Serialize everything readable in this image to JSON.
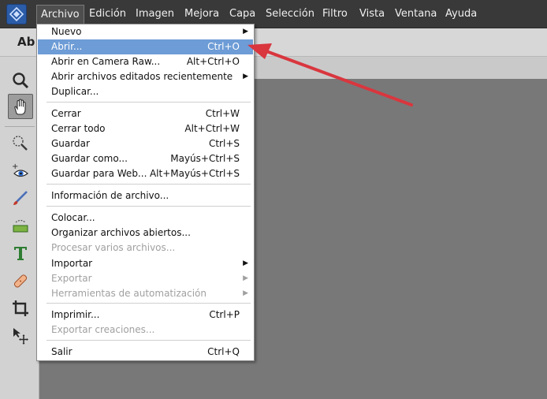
{
  "menubar": {
    "items": [
      {
        "label": "Archivo",
        "active": true
      },
      {
        "label": "Edición"
      },
      {
        "label": "Imagen"
      },
      {
        "label": "Mejora"
      },
      {
        "label": "Capa"
      },
      {
        "label": "Selección"
      },
      {
        "label": "Filtro"
      },
      {
        "label": "Vista"
      },
      {
        "label": "Ventana"
      },
      {
        "label": "Ayuda"
      }
    ]
  },
  "modebar": {
    "label": "Ab"
  },
  "toolbar": {
    "tools": [
      {
        "icon": "zoom-icon"
      },
      {
        "icon": "hand-icon",
        "selected": true
      },
      {
        "icon": "quick-selection-icon"
      },
      {
        "icon": "red-eye-icon"
      },
      {
        "icon": "brush-icon"
      },
      {
        "icon": "eraser-icon"
      },
      {
        "icon": "type-icon"
      },
      {
        "icon": "healing-bandage-icon"
      },
      {
        "icon": "crop-icon"
      },
      {
        "icon": "move-icon"
      }
    ]
  },
  "archivo_menu": {
    "items": [
      {
        "label": "Nuevo",
        "shortcut": "",
        "submenu": true
      },
      {
        "label": "Abrir...",
        "shortcut": "Ctrl+O",
        "highlighted": true
      },
      {
        "label": "Abrir en Camera Raw...",
        "shortcut": "Alt+Ctrl+O"
      },
      {
        "label": "Abrir archivos editados recientemente",
        "shortcut": "",
        "submenu": true
      },
      {
        "label": "Duplicar...",
        "shortcut": ""
      },
      {
        "label": "Cerrar",
        "shortcut": "Ctrl+W"
      },
      {
        "label": "Cerrar todo",
        "shortcut": "Alt+Ctrl+W"
      },
      {
        "label": "Guardar",
        "shortcut": "Ctrl+S"
      },
      {
        "label": "Guardar como...",
        "shortcut": "Mayús+Ctrl+S"
      },
      {
        "label": "Guardar para Web...",
        "shortcut": "Alt+Mayús+Ctrl+S"
      },
      {
        "label": "Información de archivo...",
        "shortcut": ""
      },
      {
        "label": "Colocar...",
        "shortcut": ""
      },
      {
        "label": "Organizar archivos abiertos...",
        "shortcut": ""
      },
      {
        "label": "Procesar varios archivos...",
        "shortcut": "",
        "disabled": true
      },
      {
        "label": "Importar",
        "shortcut": "",
        "submenu": true
      },
      {
        "label": "Exportar",
        "shortcut": "",
        "submenu": true,
        "disabled": true
      },
      {
        "label": "Herramientas de automatización",
        "shortcut": "",
        "submenu": true,
        "disabled": true
      },
      {
        "label": "Imprimir...",
        "shortcut": "Ctrl+P"
      },
      {
        "label": "Exportar creaciones...",
        "shortcut": "",
        "disabled": true
      },
      {
        "label": "Salir",
        "shortcut": "Ctrl+Q"
      }
    ],
    "submenu_arrow": "▶"
  },
  "colors": {
    "menubar_bg": "#393939",
    "highlight": "#6d9cd6",
    "annotation_arrow": "#d9363e"
  }
}
